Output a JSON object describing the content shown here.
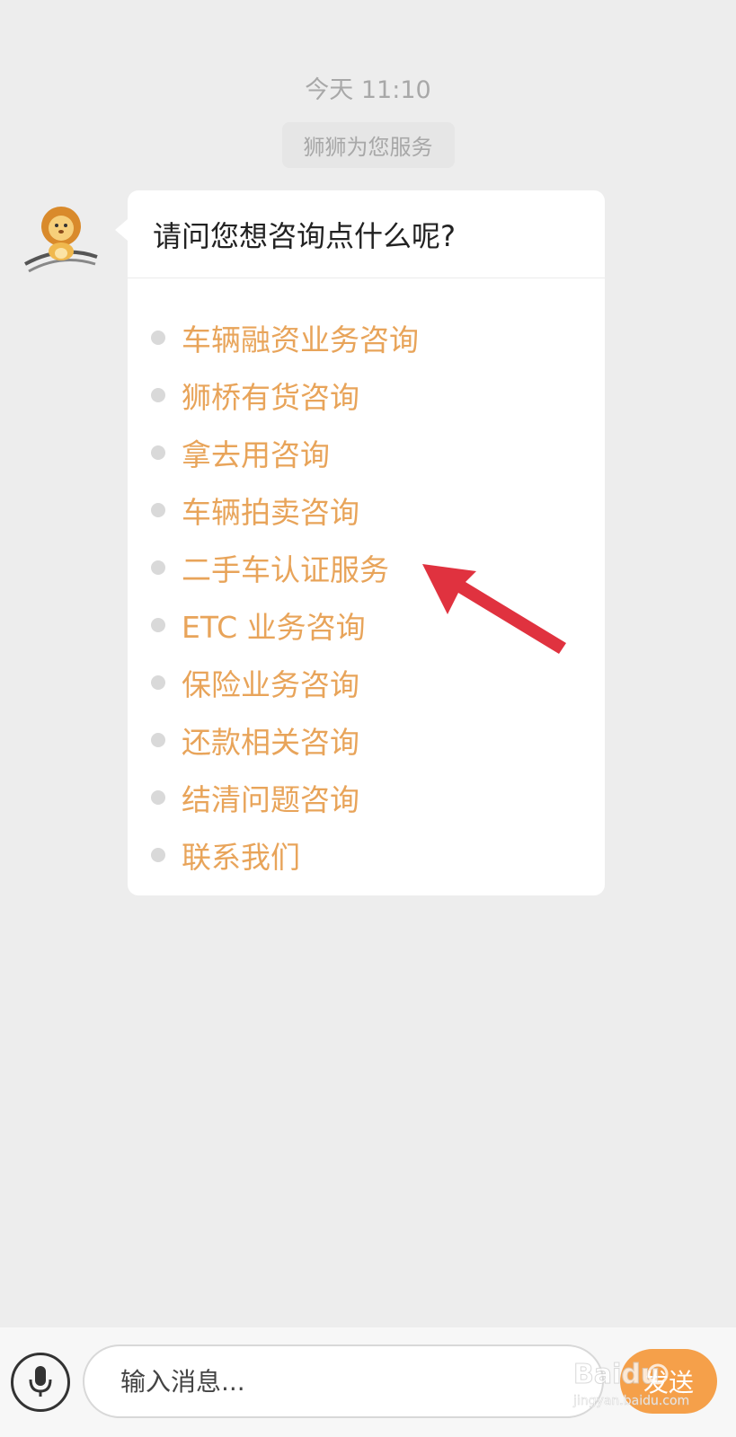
{
  "chat": {
    "timestamp": "今天 11:10",
    "service_notice": "狮狮为您服务",
    "bot_message": {
      "avatar_icon": "lion-mascot-icon",
      "question": "请问您想咨询点什么呢?",
      "options": [
        "车辆融资业务咨询",
        "狮桥有货咨询",
        "拿去用咨询",
        "车辆拍卖咨询",
        "二手车认证服务",
        "ETC 业务咨询",
        "保险业务咨询",
        "还款相关咨询",
        "结清问题咨询",
        "联系我们"
      ]
    }
  },
  "annotation": {
    "arrow_icon": "red-arrow-icon",
    "color": "#e0323f"
  },
  "input_bar": {
    "mic_icon": "microphone-icon",
    "placeholder": "输入消息...",
    "send_label": "发送"
  },
  "watermark": {
    "brand": "Baidu",
    "url": "jingyan.baidu.com"
  },
  "colors": {
    "background": "#ededed",
    "option_text": "#e8a45a",
    "send_button": "#f5a04a"
  }
}
